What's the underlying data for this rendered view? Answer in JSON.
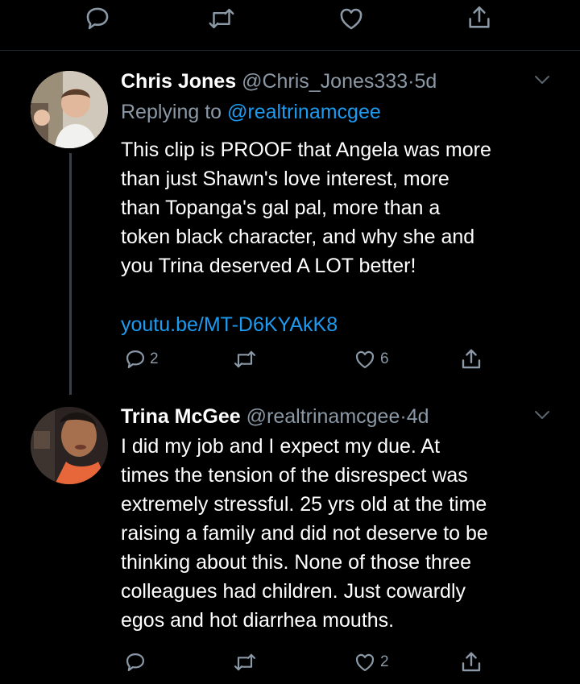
{
  "top_actions": {
    "reply_icon": "reply-icon",
    "retweet_icon": "retweet-icon",
    "like_icon": "heart-icon",
    "share_icon": "share-icon"
  },
  "tweet1": {
    "name": "Chris Jones",
    "handle": "@Chris_Jones333",
    "separator": "·",
    "time": "5d",
    "replying_to_label": "Replying to",
    "replying_to_handle": "@realtrinamcgee",
    "text": "This clip is PROOF that Angela was more\nthan just Shawn's love interest, more\nthan Topanga's gal pal, more than a\ntoken black character, and why she and\nyou Trina deserved A LOT better!",
    "link": "youtu.be/MT-D6KYAkK8",
    "reply_count": "2",
    "retweet_count": "",
    "like_count": "6"
  },
  "tweet2": {
    "name": "Trina McGee",
    "handle": "@realtrinamcgee",
    "separator": "·",
    "time": "4d",
    "text": "I did my job and I expect my due. At\ntimes the tension of the disrespect was\nextremely stressful. 25 yrs old at the time\nraising a family and did not deserve to be\nthinking about this. None of those three\ncolleagues had children. Just cowardly\negos and hot diarrhea mouths.",
    "reply_count": "",
    "retweet_count": "",
    "like_count": "2"
  },
  "colors": {
    "background": "#000000",
    "text": "#ffffff",
    "secondary": "#8b98a5",
    "link": "#1d9bf0"
  }
}
